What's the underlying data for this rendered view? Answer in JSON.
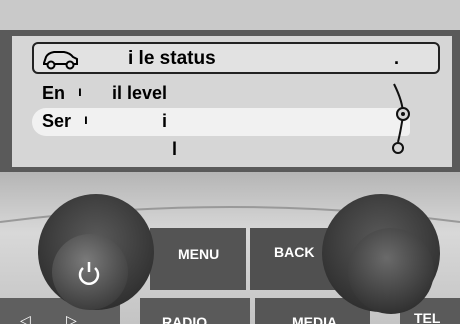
{
  "screen": {
    "header": {
      "icon": "car-icon",
      "title": "i le status",
      "trailing": "."
    },
    "rows": [
      {
        "label": "En",
        "mid": "ı",
        "value": "il level"
      },
      {
        "label": "Ser",
        "mid": "ı",
        "value": "i",
        "selected": true
      },
      {
        "label": "",
        "mid": "",
        "value": "l"
      }
    ]
  },
  "controls": {
    "menu_label": "MENU",
    "back_label": "BACK",
    "radio_label": "RADIO",
    "media_label": "MEDIA",
    "tel_label": "TEL"
  }
}
